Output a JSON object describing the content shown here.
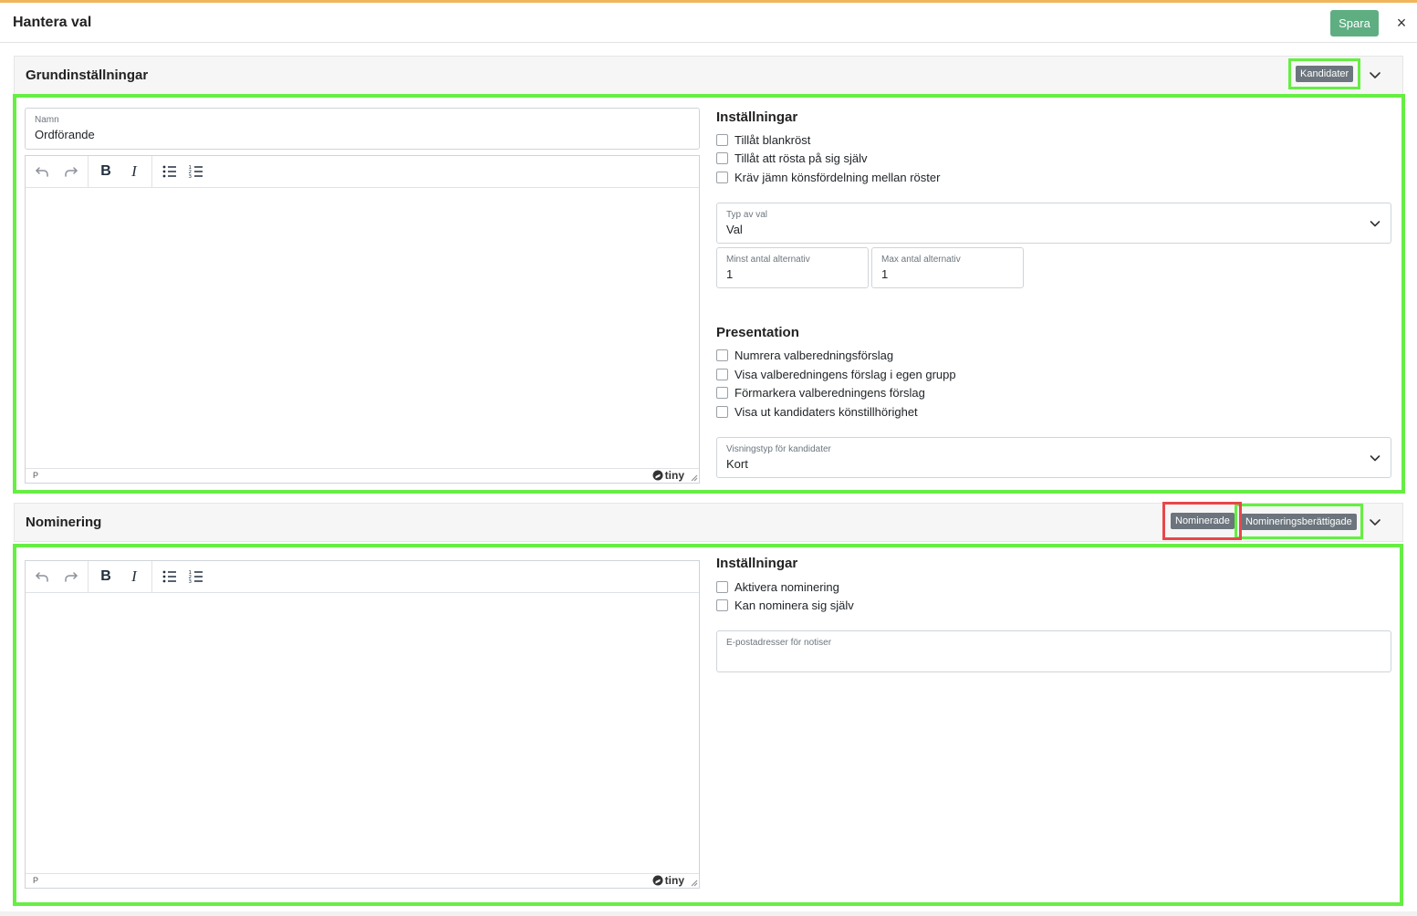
{
  "modal": {
    "title": "Hantera val",
    "save_label": "Spara",
    "close_symbol": "×"
  },
  "basic": {
    "title": "Grundinställningar",
    "badge_candidates": "Kandidater",
    "name_label": "Namn",
    "name_value": "Ordförande",
    "editor_path": "P",
    "tiny_brand": "tiny",
    "settings_title": "Inställningar",
    "settings_options": [
      "Tillåt blankröst",
      "Tillåt att rösta på sig själv",
      "Kräv jämn könsfördelning mellan röster"
    ],
    "election_type_label": "Typ av val",
    "election_type_value": "Val",
    "min_label": "Minst antal alternativ",
    "min_value": "1",
    "max_label": "Max antal alternativ",
    "max_value": "1",
    "presentation_title": "Presentation",
    "presentation_options": [
      "Numrera valberedningsförslag",
      "Visa valberedningens förslag i egen grupp",
      "Förmarkera valberedningens förslag",
      "Visa ut kandidaters könstillhörighet"
    ],
    "display_type_label": "Visningstyp för kandidater",
    "display_type_value": "Kort"
  },
  "nomination": {
    "title": "Nominering",
    "badge_nominated": "Nominerade",
    "badge_eligible": "Nomineringsberättigade",
    "editor_path": "P",
    "tiny_brand": "tiny",
    "settings_title": "Inställningar",
    "settings_options": [
      "Aktivera nominering",
      "Kan nominera sig själv"
    ],
    "email_label": "E-postadresser för notiser",
    "email_value": ""
  },
  "colors": {
    "accent_top": "#f0b45a",
    "save_button": "#5fae82",
    "highlight_green": "#66ee44",
    "highlight_red": "#e8474a",
    "badge": "#6c757d"
  },
  "icons": {
    "close": "close-icon",
    "chevron": "chevron-down-icon",
    "undo": "undo-icon",
    "redo": "redo-icon",
    "bold": "bold-icon",
    "italic": "italic-icon",
    "bullet_list": "bullet-list-icon",
    "numbered_list": "numbered-list-icon"
  }
}
